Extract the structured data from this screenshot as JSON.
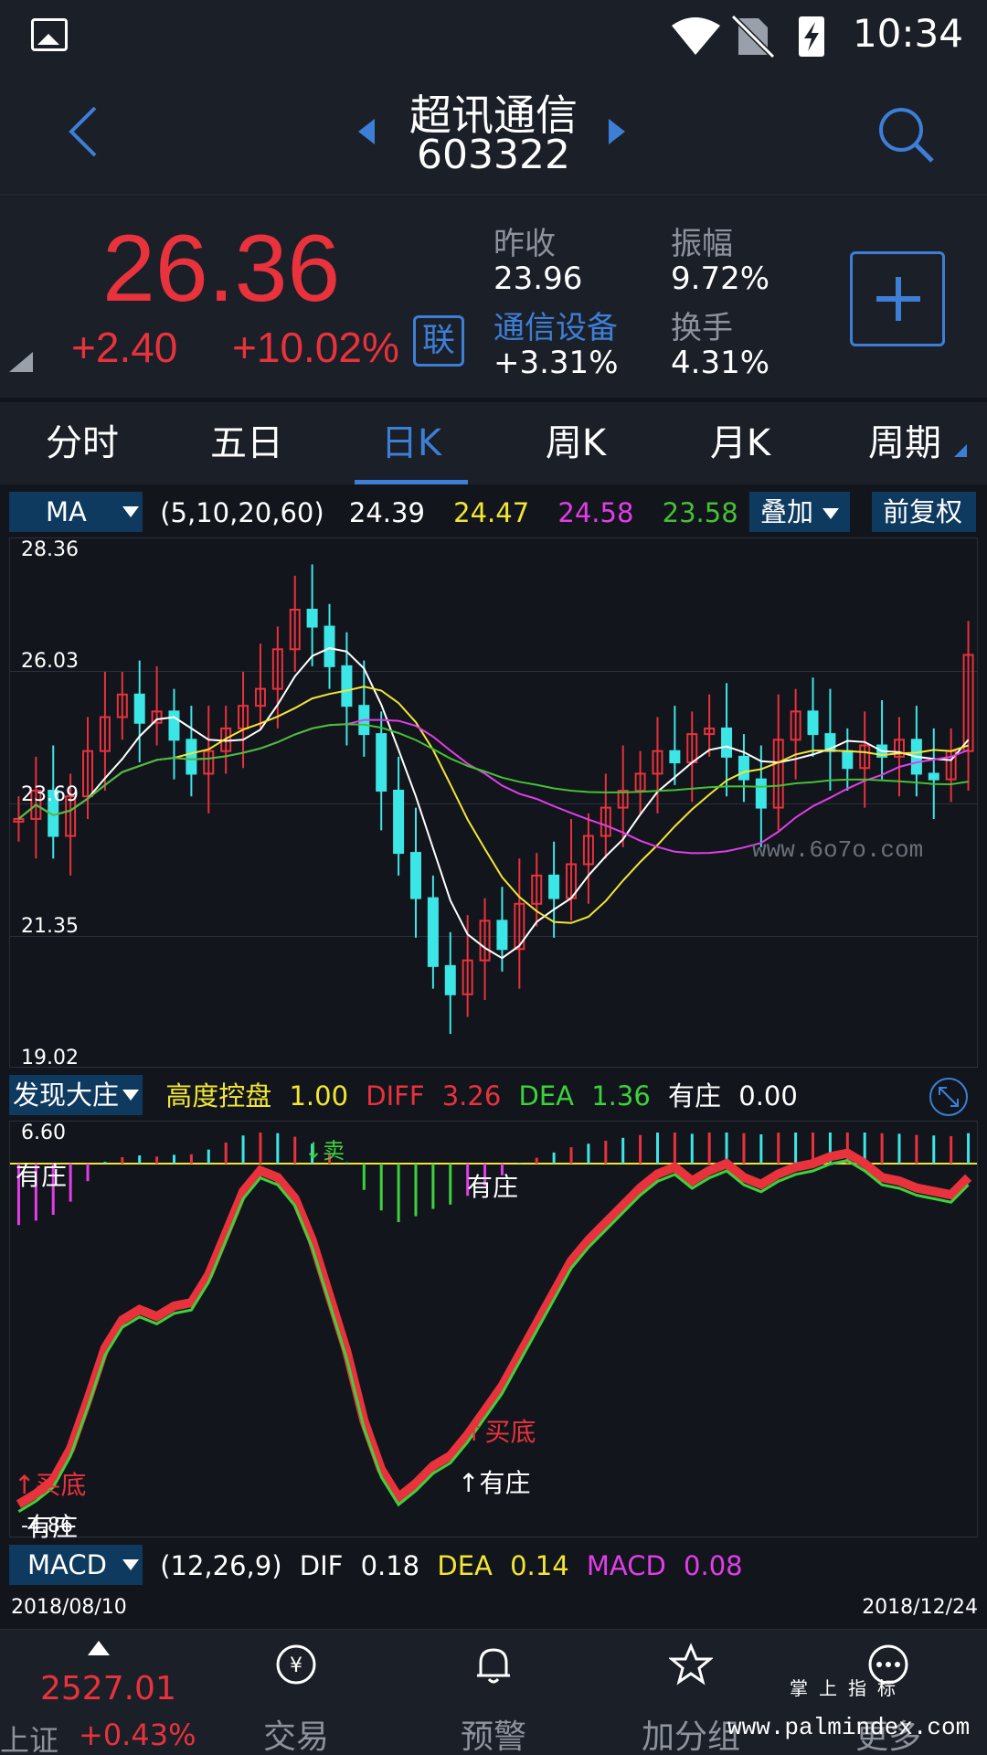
{
  "status_bar": {
    "time": "10:34"
  },
  "header": {
    "stock_name": "超讯通信",
    "stock_code": "603322"
  },
  "quote": {
    "price": "26.36",
    "change": "+2.40",
    "change_pct": "+10.02%",
    "link_badge": "联",
    "prev_close_label": "昨收",
    "prev_close": "23.96",
    "amplitude_label": "振幅",
    "amplitude": "9.72%",
    "sector_name": "通信设备",
    "sector_change": "+3.31%",
    "turnover_label": "换手",
    "turnover": "4.31%"
  },
  "tabs": [
    {
      "label": "分时"
    },
    {
      "label": "五日"
    },
    {
      "label": "日K"
    },
    {
      "label": "周K"
    },
    {
      "label": "月K"
    },
    {
      "label": "周期"
    }
  ],
  "active_tab": "日K",
  "ma_bar": {
    "selector": "MA",
    "params": "(5,10,20,60)",
    "ma5": "24.39",
    "ma10": "24.47",
    "ma20": "24.58",
    "ma60": "23.58",
    "overlay_button": "叠加",
    "adjust_button": "前复权"
  },
  "kline_axis": {
    "max": "28.36",
    "l2": "26.03",
    "l3": "23.69",
    "l4": "21.35",
    "min": "19.02"
  },
  "indicator_bar": {
    "selector": "发现大庄",
    "name": "高度控盘",
    "name_val": "1.00",
    "diff_label": "DIFF",
    "diff_val": "3.26",
    "dea_label": "DEA",
    "dea_val": "1.36",
    "zhuang_label": "有庄",
    "zhuang_val": "0.00"
  },
  "indicator_chart": {
    "top": "6.60",
    "bottom": "-4.86",
    "labels": {
      "zhuang": "有庄",
      "sell": "↓卖",
      "buy_bottom": "↑买底",
      "zhuang_up": "↑有庄"
    }
  },
  "macd_bar": {
    "selector": "MACD",
    "params": "(12,26,9)",
    "dif_label": "DIF",
    "dif_val": "0.18",
    "dea_label": "DEA",
    "dea_val": "0.14",
    "macd_label": "MACD",
    "macd_val": "0.08"
  },
  "dates": {
    "start": "2018/08/10",
    "end": "2018/12/24"
  },
  "watermarks": {
    "site1": "www.6o7o.com",
    "brand": "掌 上 指 标",
    "site2": "www.palmindex.com"
  },
  "bottom_nav": {
    "index_value": "2527.01",
    "index_name": "上证",
    "index_pct": "+0.43%",
    "items": [
      {
        "label": "交易"
      },
      {
        "label": "预警"
      },
      {
        "label": "加分组"
      },
      {
        "label": "更多"
      }
    ]
  },
  "colors": {
    "up": "#e8323c",
    "down": "#3de6e6",
    "accent": "#3d7fd6",
    "ma5": "#ffffff",
    "ma10": "#f2e635",
    "ma20": "#e13ee8",
    "ma60": "#46c035"
  }
}
